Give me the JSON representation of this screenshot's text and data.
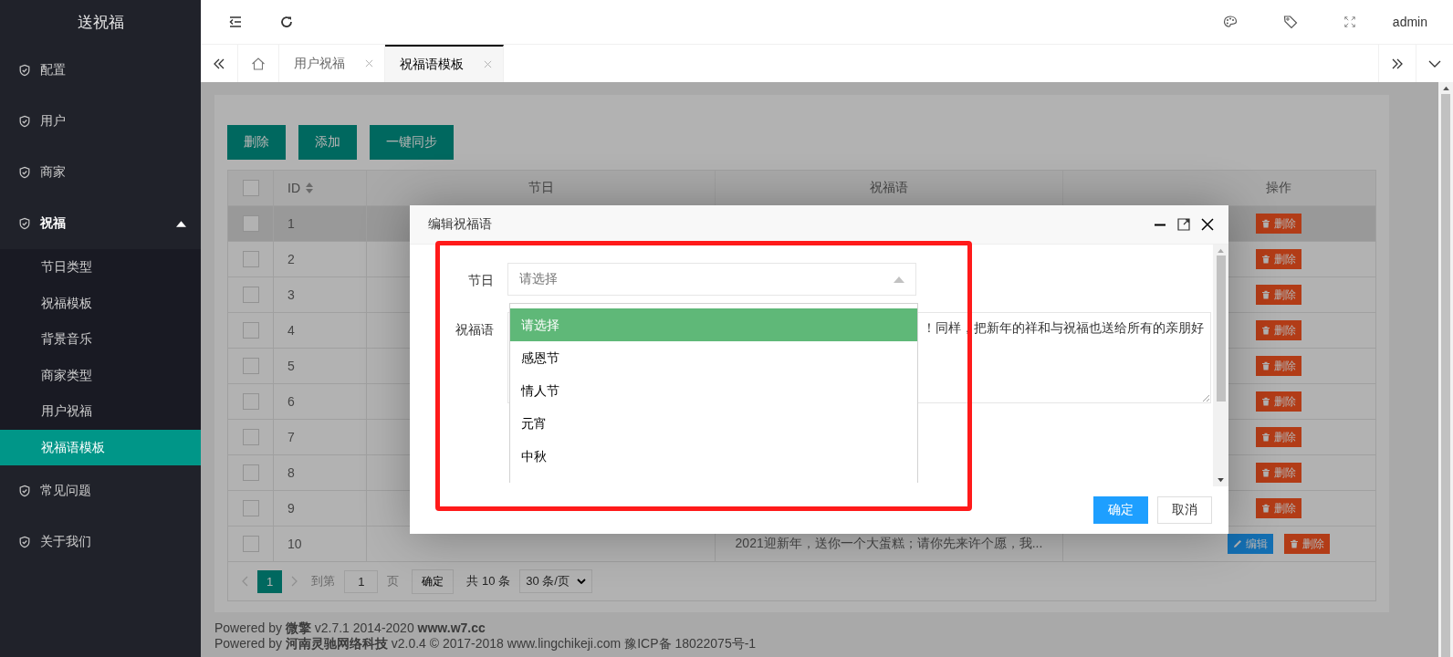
{
  "sidebar": {
    "title": "送祝福",
    "items": [
      {
        "label": "配置"
      },
      {
        "label": "用户"
      },
      {
        "label": "商家"
      },
      {
        "label": "祝福",
        "expanded": true,
        "children": [
          {
            "label": "节日类型",
            "selected": false
          },
          {
            "label": "祝福模板",
            "selected": false
          },
          {
            "label": "背景音乐",
            "selected": false
          },
          {
            "label": "商家类型",
            "selected": false
          },
          {
            "label": "用户祝福",
            "selected": false
          },
          {
            "label": "祝福语模板",
            "selected": true
          }
        ]
      },
      {
        "label": "常见问题"
      },
      {
        "label": "关于我们"
      }
    ]
  },
  "header": {
    "user": "admin"
  },
  "tabs": [
    {
      "label": "用户祝福",
      "selected": false
    },
    {
      "label": "祝福语模板",
      "selected": true
    }
  ],
  "toolbar": [
    "删除",
    "添加",
    "一键同步"
  ],
  "table": {
    "all_checked": false,
    "columns": [
      {
        "label": "ID",
        "kind": "sortable"
      },
      {
        "label": "节日",
        "kind": "plain"
      },
      {
        "label": "祝福语",
        "kind": "plain"
      },
      {
        "label": "操作",
        "kind": "plain"
      }
    ],
    "rows": [
      {
        "id": "1",
        "checked": false,
        "highlighted": true,
        "actions": [
          {
            "kind": "delete",
            "label": "删除"
          }
        ]
      },
      {
        "id": "2",
        "checked": false,
        "highlighted": false,
        "actions": [
          {
            "kind": "delete",
            "label": "删除"
          }
        ]
      },
      {
        "id": "3",
        "checked": false,
        "highlighted": false,
        "actions": [
          {
            "kind": "delete",
            "label": "删除"
          }
        ]
      },
      {
        "id": "4",
        "checked": false,
        "highlighted": false,
        "actions": [
          {
            "kind": "delete",
            "label": "删除"
          }
        ]
      },
      {
        "id": "5",
        "checked": false,
        "highlighted": false,
        "actions": [
          {
            "kind": "delete",
            "label": "删除"
          }
        ]
      },
      {
        "id": "6",
        "checked": false,
        "highlighted": false,
        "actions": [
          {
            "kind": "delete",
            "label": "删除"
          }
        ]
      },
      {
        "id": "7",
        "checked": false,
        "highlighted": false,
        "actions": [
          {
            "kind": "delete",
            "label": "删除"
          }
        ]
      },
      {
        "id": "8",
        "checked": false,
        "highlighted": false,
        "actions": [
          {
            "kind": "delete",
            "label": "删除"
          }
        ]
      },
      {
        "id": "9",
        "checked": false,
        "highlighted": false,
        "actions": [
          {
            "kind": "delete",
            "label": "删除"
          }
        ]
      },
      {
        "id": "10",
        "checked": false,
        "highlighted": false,
        "greeting": "2021迎新年，送你一个大蛋糕；请你先来许个愿，我...",
        "actions": [
          {
            "kind": "edit",
            "label": "编辑"
          },
          {
            "kind": "delete",
            "label": "删除"
          }
        ]
      }
    ]
  },
  "pagination": {
    "pages": [
      {
        "label": "1",
        "selected": true
      }
    ],
    "goto_label": "到第",
    "page_value": "1",
    "page_unit": "页",
    "confirm": "确定",
    "total": "共 10 条",
    "page_size": "30 条/页"
  },
  "footer": [
    "Powered by **微擎** v2.7.1 2014-2020 **www.w7.cc**",
    "Powered by **河南灵驰网络科技** v2.0.4 © 2017-2018 www.lingchikeji.com 豫ICP备 18022075号-1"
  ],
  "modal": {
    "title": "编辑祝福语",
    "fields": [
      {
        "kind": "select",
        "label": "节日",
        "placeholder": "请选择",
        "open": true,
        "options": [
          {
            "label": "请选择",
            "selected": true
          },
          {
            "label": "感恩节",
            "selected": false
          },
          {
            "label": "情人节",
            "selected": false
          },
          {
            "label": "元宵",
            "selected": false
          },
          {
            "label": "中秋",
            "selected": false
          }
        ]
      },
      {
        "kind": "textarea",
        "label": "祝福语",
        "value": "！同样，把新年的祥和与祝福也送给所有的亲朋好"
      }
    ],
    "buttons": [
      {
        "kind": "primary",
        "label": "确定"
      },
      {
        "kind": "default",
        "label": "取消"
      }
    ]
  }
}
